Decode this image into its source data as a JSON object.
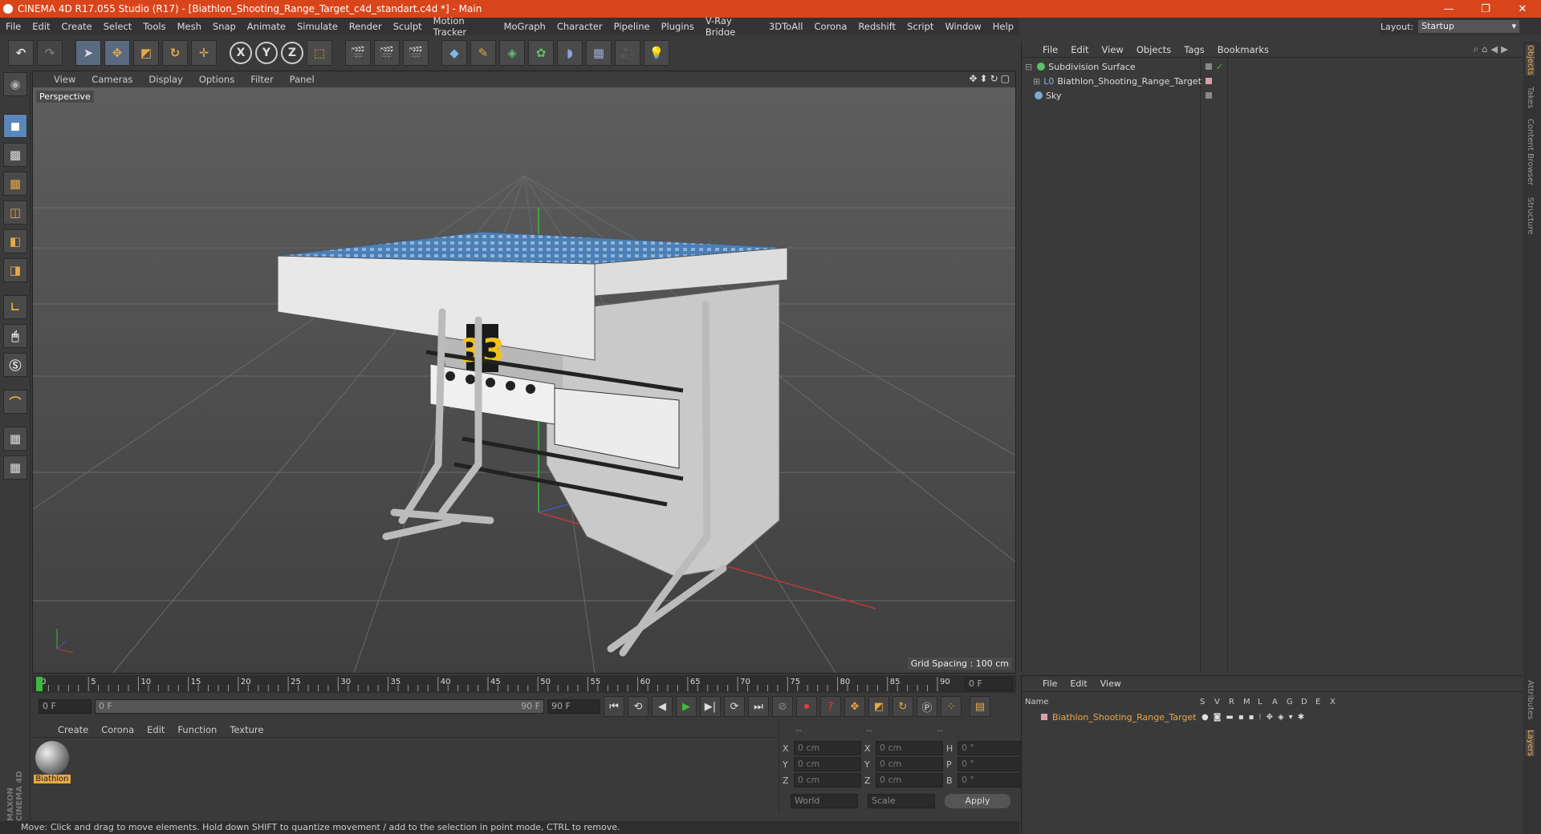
{
  "window": {
    "title": "CINEMA 4D R17.055 Studio (R17) - [Biathlon_Shooting_Range_Target_c4d_standart.c4d *] - Main",
    "controls": [
      "—",
      "❐",
      "✕"
    ]
  },
  "menubar": [
    "File",
    "Edit",
    "Create",
    "Select",
    "Tools",
    "Mesh",
    "Snap",
    "Animate",
    "Simulate",
    "Render",
    "Sculpt",
    "Motion Tracker",
    "MoGraph",
    "Character",
    "Pipeline",
    "Plugins",
    "V-Ray Bridge",
    "3DToAll",
    "Corona",
    "Redshift",
    "Script",
    "Window",
    "Help"
  ],
  "layout": {
    "label": "Layout:",
    "value": "Startup"
  },
  "viewport": {
    "menu": [
      "View",
      "Cameras",
      "Display",
      "Options",
      "Filter",
      "Panel"
    ],
    "camera_label": "Perspective",
    "grid_spacing": "Grid Spacing : 100 cm",
    "sign_number": "33"
  },
  "timeline": {
    "ticks": [
      "0",
      "5",
      "10",
      "15",
      "20",
      "25",
      "30",
      "35",
      "40",
      "45",
      "50",
      "55",
      "60",
      "65",
      "70",
      "75",
      "80",
      "85",
      "90"
    ],
    "current_frame_readout": "0 F",
    "start_field": "0 F",
    "range_start": "0 F",
    "range_end": "90 F",
    "end_field": "90 F"
  },
  "materials": {
    "menu": [
      "Create",
      "Corona",
      "Edit",
      "Function",
      "Texture"
    ],
    "items": [
      {
        "name": "Biathlon"
      }
    ]
  },
  "coords": {
    "header": [
      "--",
      "--",
      "--"
    ],
    "rows": [
      {
        "a": "X",
        "av": "0 cm",
        "b": "X",
        "bv": "0 cm",
        "c": "H",
        "cv": "0 °"
      },
      {
        "a": "Y",
        "av": "0 cm",
        "b": "Y",
        "bv": "0 cm",
        "c": "P",
        "cv": "0 °"
      },
      {
        "a": "Z",
        "av": "0 cm",
        "b": "Z",
        "bv": "0 cm",
        "c": "B",
        "cv": "0 °"
      }
    ],
    "world": "World",
    "scale": "Scale",
    "apply": "Apply"
  },
  "status": "Move: Click and drag to move elements. Hold down SHIFT to quantize movement / add to the selection in point mode, CTRL to remove.",
  "object_manager": {
    "menu": [
      "File",
      "Edit",
      "View",
      "Objects",
      "Tags",
      "Bookmarks"
    ],
    "objects": [
      {
        "name": "Subdivision Surface",
        "color": "#5bbf6a"
      },
      {
        "name": "Biathlon_Shooting_Range_Target",
        "color": "#d8a0a8"
      },
      {
        "name": "Sky",
        "color": "#7aa8d8"
      }
    ]
  },
  "layer_manager": {
    "menu": [
      "File",
      "Edit",
      "View"
    ],
    "columns": [
      "Name",
      "S",
      "V",
      "R",
      "M",
      "L",
      "A",
      "G",
      "D",
      "E",
      "X"
    ],
    "layers": [
      {
        "name": "Biathlon_Shooting_Range_Target",
        "color": "#e6a94a"
      }
    ]
  },
  "side_tabs": [
    "Objects",
    "Takes",
    "Content Browser",
    "Structure"
  ],
  "side_tabs_lower": [
    "Attributes",
    "Layers"
  ],
  "brand": "MAXON CINEMA 4D"
}
